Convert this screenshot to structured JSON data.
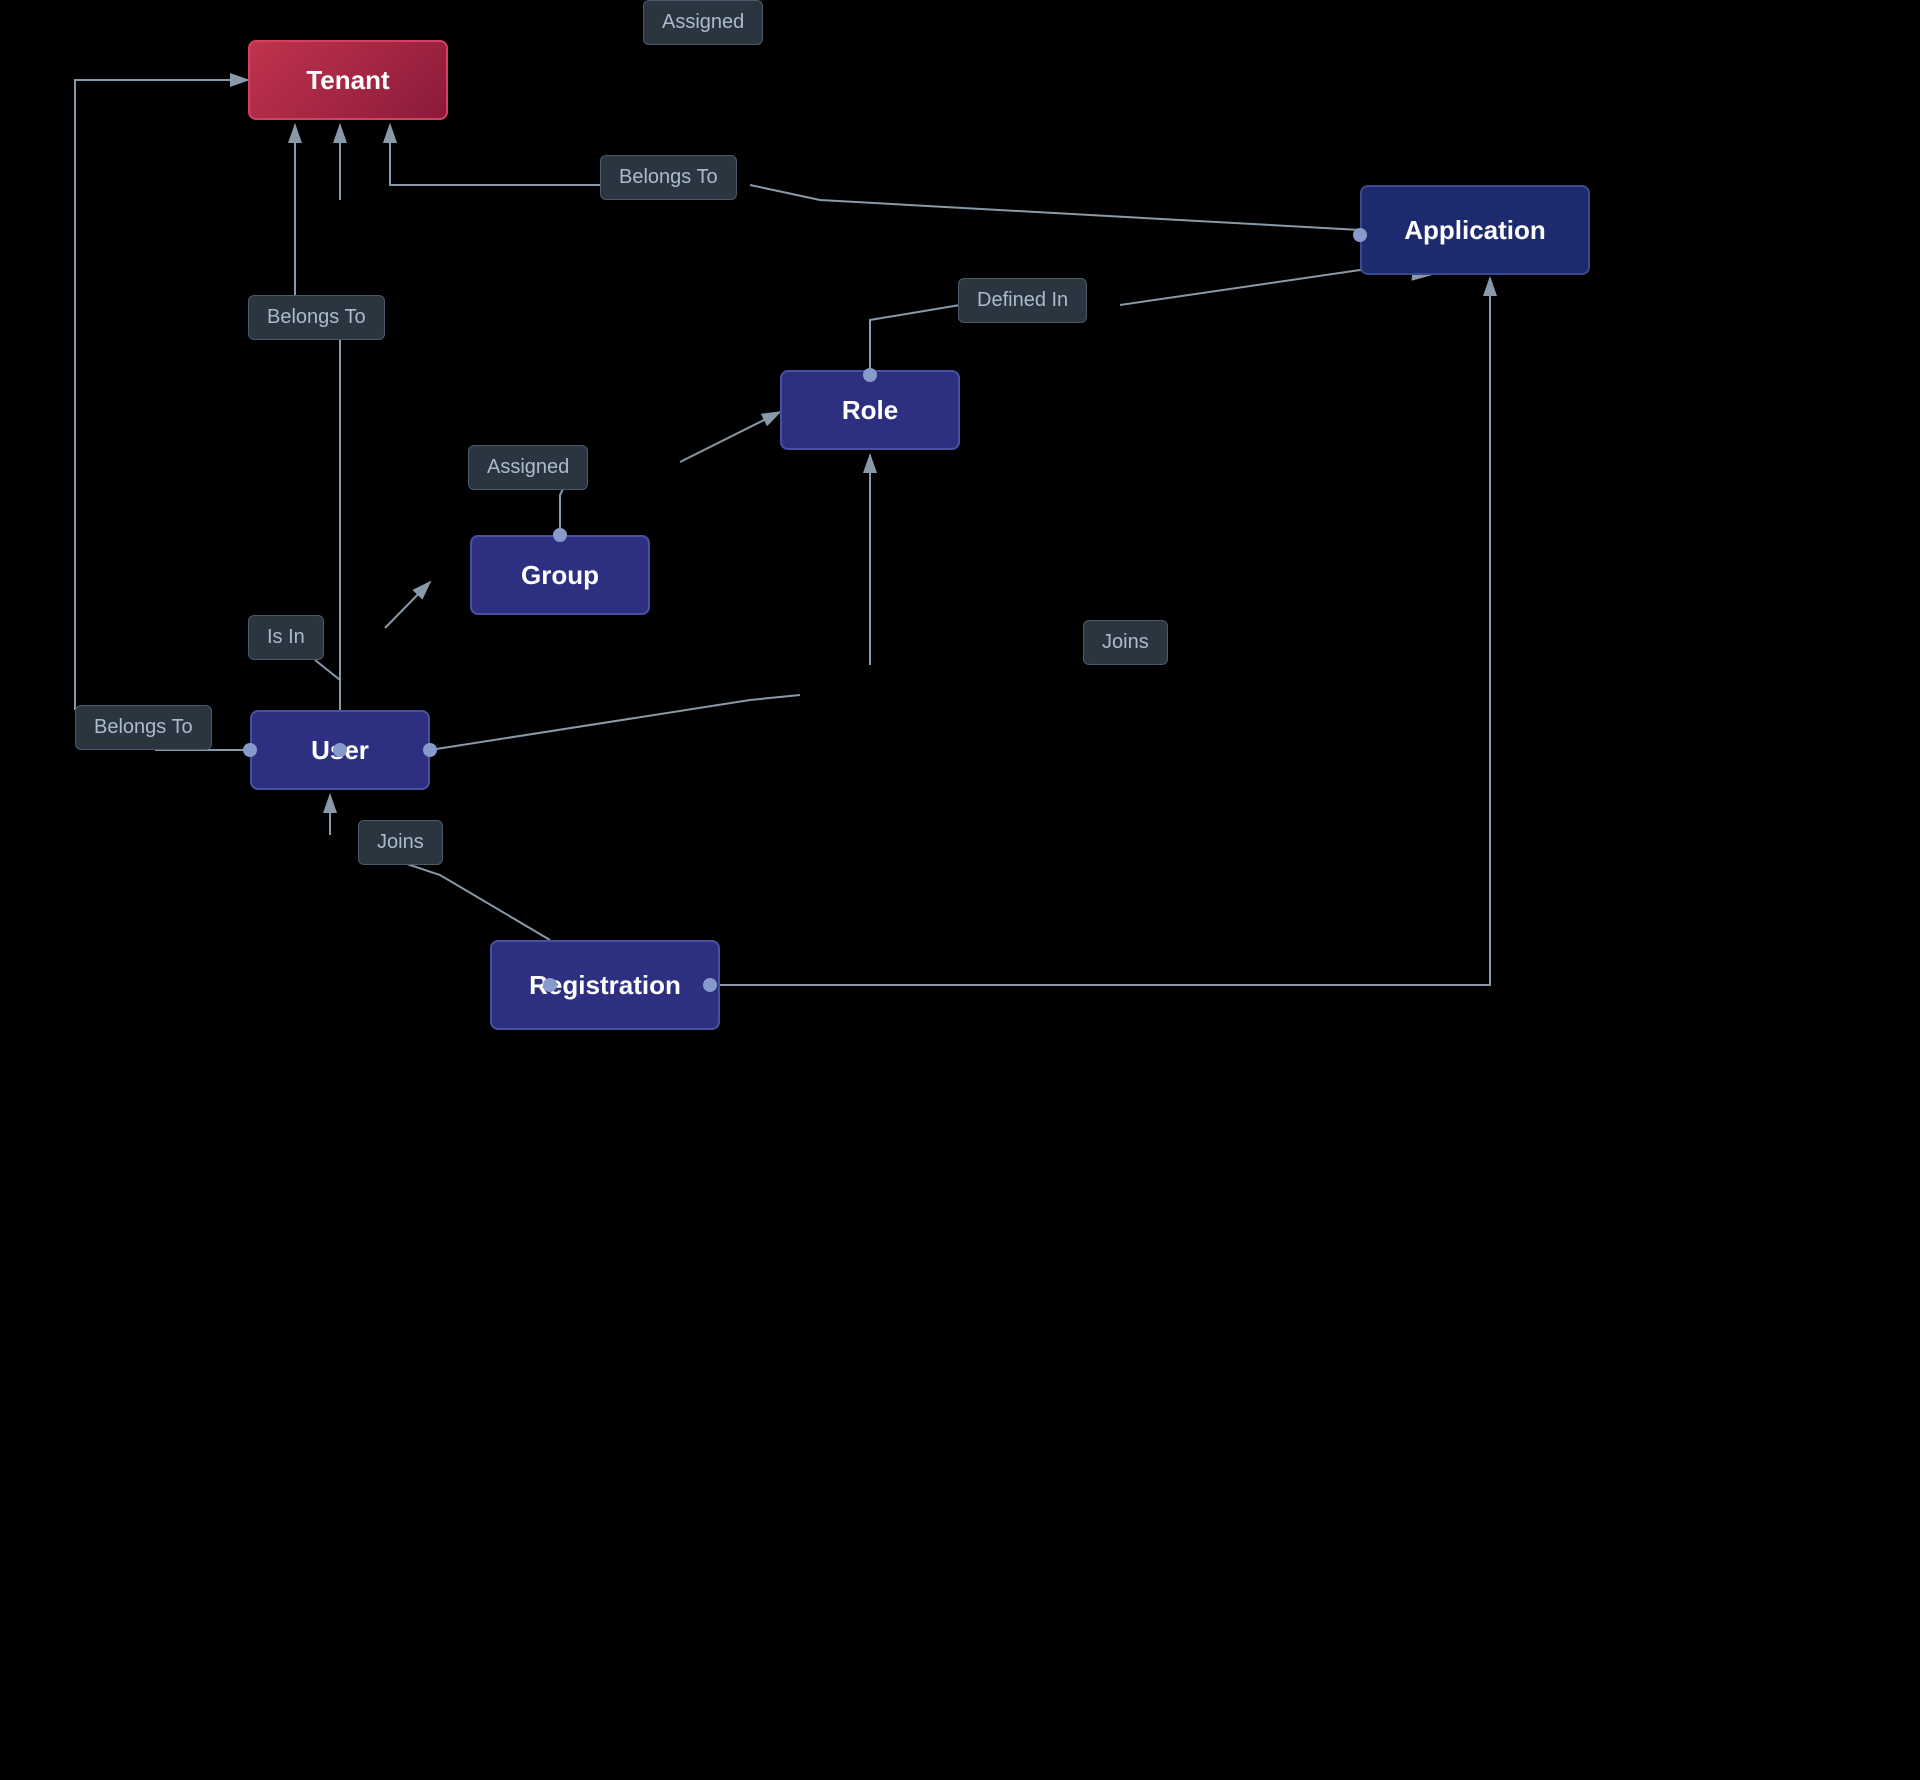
{
  "nodes": {
    "tenant": {
      "label": "Tenant"
    },
    "application": {
      "label": "Application"
    },
    "role": {
      "label": "Role"
    },
    "group": {
      "label": "Group"
    },
    "user": {
      "label": "User"
    },
    "registration": {
      "label": "Registration"
    }
  },
  "edgeLabels": {
    "belongs_to_1": "Belongs To",
    "belongs_to_2": "Belongs To",
    "belongs_to_3": "Belongs To",
    "defined_in": "Defined In",
    "assigned_1": "Assigned",
    "assigned_2": "Assigned",
    "is_in": "Is In",
    "joins_1": "Joins",
    "joins_2": "Joins"
  }
}
